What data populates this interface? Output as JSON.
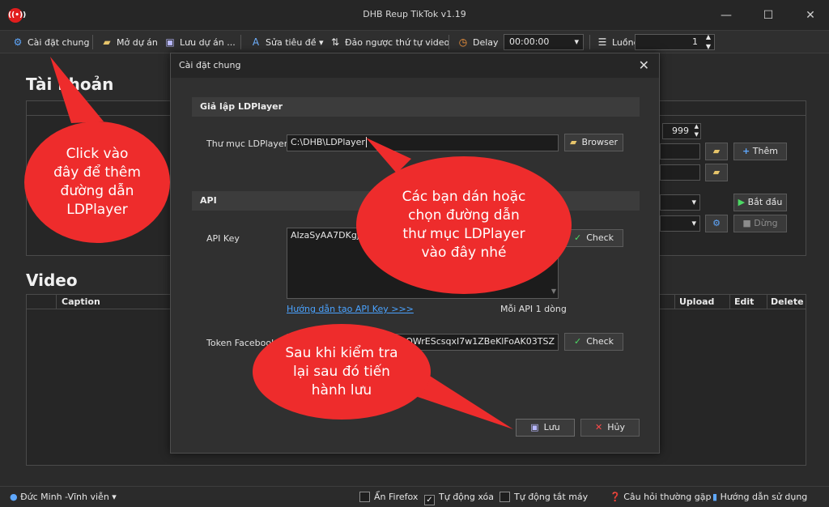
{
  "window": {
    "title": "DHB Reup TikTok v1.19",
    "minimize": "—",
    "maximize": "☐",
    "close": "✕"
  },
  "toolbar": {
    "settings": "Cài đặt chung",
    "open_project": "Mở dự án",
    "save_project": "Lưu dự án ...",
    "edit_title": "Sửa tiêu đề",
    "reverse_order": "Đảo ngược thứ tự video",
    "delay_label": "Delay",
    "delay_value": "00:00:00",
    "threads_label": "Luồng",
    "threads_value": "1"
  },
  "main": {
    "account_title": "Tài khoản",
    "video_title": "Video",
    "account_count": "999",
    "add_button": "Thêm",
    "start_button": "Bắt đầu",
    "stop_button": "Dừng",
    "video_columns": {
      "caption": "Caption",
      "upload": "Upload",
      "edit": "Edit",
      "delete": "Delete"
    }
  },
  "status_bar": {
    "user": "Đức Minh -Vĩnh viễn",
    "hide_firefox": "Ẩn Firefox",
    "auto_delete": "Tự động xóa",
    "auto_shutdown": "Tự động tắt máy",
    "faq": "Câu hỏi thường gặp",
    "guide": "Hướng dẫn sử dụng"
  },
  "dialog": {
    "title": "Cài đặt chung",
    "close": "✕",
    "ldplayer_group": "Giả lập LDPlayer",
    "ldplayer_folder_label": "Thư mục LDPlayer",
    "ldplayer_folder_value": "C:\\DHB\\LDPlayer",
    "browse_button": "Browser",
    "api_group": "API",
    "api_key_label": "API Key",
    "api_key_value": "AIzaSyAA7DKgjq",
    "check_button": "Check",
    "api_guide_link": "Hướng dẫn tạo API Key >>>",
    "api_per_line": "Mỗi API 1 dòng",
    "token_label": "Token Facebook",
    "token_value": "DOWrEScsqxI7w1ZBeKlFoAK03TSZ",
    "token_check_button": "Check",
    "save_button": "Lưu",
    "cancel_button": "Hủy"
  },
  "callouts": {
    "click_here": [
      "Click vào",
      "đây để thêm",
      "đường dẫn",
      "LDPlayer"
    ],
    "paste_path": [
      "Các bạn dán hoặc",
      "chọn đường dẫn",
      "thư mục LDPlayer",
      "vào đây nhé"
    ],
    "save_after": [
      "Sau khi kiểm tra",
      "lại sau đó tiến",
      "hành lưu"
    ]
  },
  "colors": {
    "callout_red": "#ee2c2c",
    "link_blue": "#4aa3ff",
    "app_icon_red": "#e11d1d"
  }
}
